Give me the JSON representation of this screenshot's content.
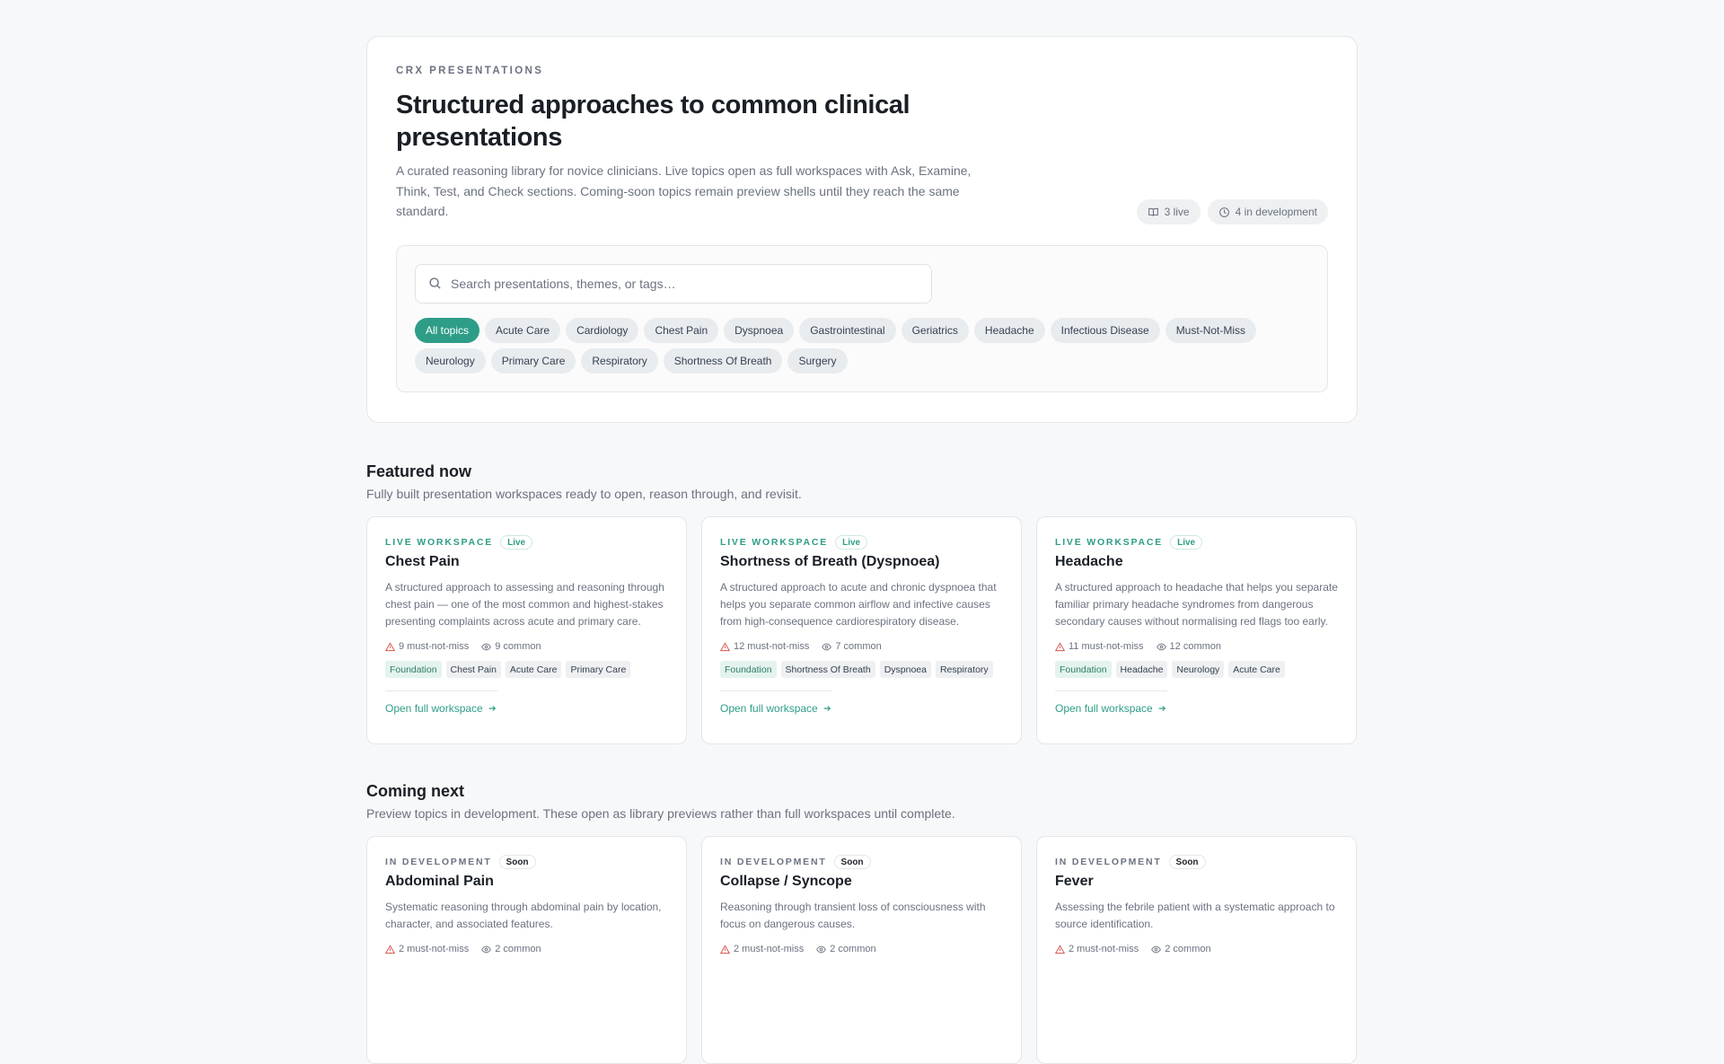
{
  "hero": {
    "eyebrow": "CRX PRESENTATIONS",
    "title": "Structured approaches to common clinical presentations",
    "description": "A curated reasoning library for novice clinicians. Live topics open as full workspaces with Ask, Examine, Think, Test, and Check sections. Coming-soon topics remain preview shells until they reach the same standard.",
    "stats": {
      "live": "3 live",
      "dev": "4 in development"
    }
  },
  "search": {
    "placeholder": "Search presentations, themes, or tags…"
  },
  "filters": [
    "All topics",
    "Acute Care",
    "Cardiology",
    "Chest Pain",
    "Dyspnoea",
    "Gastrointestinal",
    "Geriatrics",
    "Headache",
    "Infectious Disease",
    "Must-Not-Miss",
    "Neurology",
    "Primary Care",
    "Respiratory",
    "Shortness Of Breath",
    "Surgery"
  ],
  "featured": {
    "title": "Featured now",
    "subtitle": "Fully built presentation workspaces ready to open, reason through, and revisit.",
    "cards": [
      {
        "kicker": "LIVE WORKSPACE",
        "badge": "Live",
        "title": "Chest Pain",
        "description": "A structured approach to assessing and reasoning through chest pain — one of the most common and highest-stakes presenting complaints across acute and primary care.",
        "mustnotmiss": "9 must-not-miss",
        "common": "9 common",
        "tags": [
          "Foundation",
          "Chest Pain",
          "Acute Care",
          "Primary Care"
        ],
        "link": "Open full workspace"
      },
      {
        "kicker": "LIVE WORKSPACE",
        "badge": "Live",
        "title": "Shortness of Breath (Dyspnoea)",
        "description": "A structured approach to acute and chronic dyspnoea that helps you separate common airflow and infective causes from high-consequence cardiorespiratory disease.",
        "mustnotmiss": "12 must-not-miss",
        "common": "7 common",
        "tags": [
          "Foundation",
          "Shortness Of Breath",
          "Dyspnoea",
          "Respiratory"
        ],
        "link": "Open full workspace"
      },
      {
        "kicker": "LIVE WORKSPACE",
        "badge": "Live",
        "title": "Headache",
        "description": "A structured approach to headache that helps you separate familiar primary headache syndromes from dangerous secondary causes without normalising red flags too early.",
        "mustnotmiss": "11 must-not-miss",
        "common": "12 common",
        "tags": [
          "Foundation",
          "Headache",
          "Neurology",
          "Acute Care"
        ],
        "link": "Open full workspace"
      }
    ]
  },
  "coming": {
    "title": "Coming next",
    "subtitle": "Preview topics in development. These open as library previews rather than full workspaces until complete.",
    "cards": [
      {
        "kicker": "IN DEVELOPMENT",
        "badge": "Soon",
        "title": "Abdominal Pain",
        "description": "Systematic reasoning through abdominal pain by location, character, and associated features.",
        "mustnotmiss": "2 must-not-miss",
        "common": "2 common"
      },
      {
        "kicker": "IN DEVELOPMENT",
        "badge": "Soon",
        "title": "Collapse / Syncope",
        "description": "Reasoning through transient loss of consciousness with focus on dangerous causes.",
        "mustnotmiss": "2 must-not-miss",
        "common": "2 common"
      },
      {
        "kicker": "IN DEVELOPMENT",
        "badge": "Soon",
        "title": "Fever",
        "description": "Assessing the febrile patient with a systematic approach to source identification.",
        "mustnotmiss": "2 must-not-miss",
        "common": "2 common"
      }
    ]
  }
}
